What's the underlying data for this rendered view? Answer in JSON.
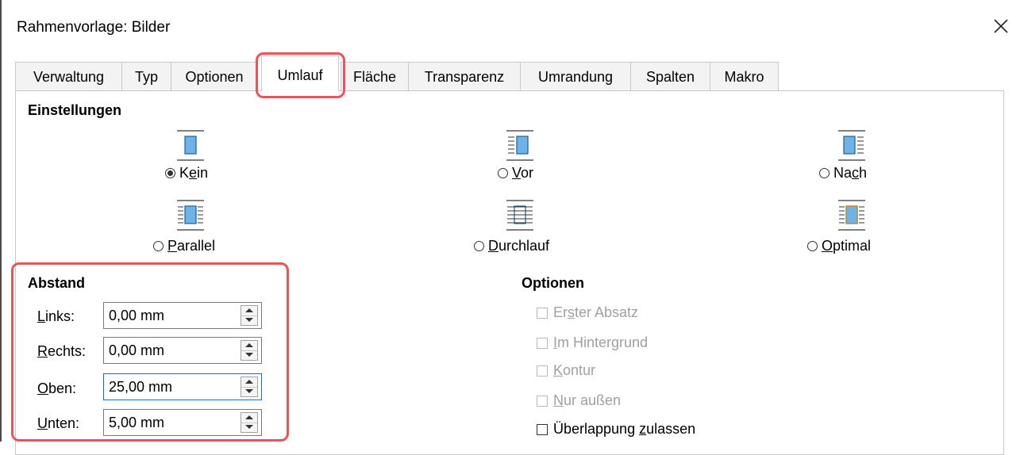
{
  "window": {
    "title": "Rahmenvorlage: Bilder"
  },
  "tabs": [
    {
      "label": "Verwaltung",
      "active": false
    },
    {
      "label": "Typ",
      "active": false
    },
    {
      "label": "Optionen",
      "active": false
    },
    {
      "label": "Umlauf",
      "active": true
    },
    {
      "label": "Fläche",
      "active": false
    },
    {
      "label": "Transparenz",
      "active": false
    },
    {
      "label": "Umrandung",
      "active": false
    },
    {
      "label": "Spalten",
      "active": false
    },
    {
      "label": "Makro",
      "active": false
    }
  ],
  "settings": {
    "heading": "Einstellungen",
    "wrap_options": [
      {
        "pre": "K",
        "mnemonic": "e",
        "post": "in",
        "checked": true,
        "icon": "wrap-none-icon"
      },
      {
        "pre": "",
        "mnemonic": "V",
        "post": "or",
        "checked": false,
        "icon": "wrap-before-icon"
      },
      {
        "pre": "Na",
        "mnemonic": "c",
        "post": "h",
        "checked": false,
        "icon": "wrap-after-icon"
      },
      {
        "pre": "",
        "mnemonic": "P",
        "post": "arallel",
        "checked": false,
        "icon": "wrap-parallel-icon"
      },
      {
        "pre": "",
        "mnemonic": "D",
        "post": "urchlauf",
        "checked": false,
        "icon": "wrap-through-icon"
      },
      {
        "pre": "",
        "mnemonic": "O",
        "post": "ptimal",
        "checked": false,
        "icon": "wrap-optimal-icon"
      }
    ]
  },
  "spacing": {
    "heading": "Abstand",
    "fields": [
      {
        "mnemonic": "L",
        "post": "inks:",
        "value": "0,00 mm"
      },
      {
        "mnemonic": "R",
        "post": "echts:",
        "value": "0,00 mm"
      },
      {
        "mnemonic": "O",
        "post": "ben:",
        "value": "25,00 mm"
      },
      {
        "mnemonic": "U",
        "post": "nten:",
        "value": "5,00 mm"
      }
    ]
  },
  "options": {
    "heading": "Optionen",
    "items": [
      {
        "pre": "Er",
        "mnemonic": "s",
        "post": "ter Absatz",
        "checked": false,
        "enabled": false
      },
      {
        "pre": "",
        "mnemonic": "I",
        "post": "m Hintergrund",
        "checked": false,
        "enabled": false
      },
      {
        "pre": "",
        "mnemonic": "K",
        "post": "ontur",
        "checked": false,
        "enabled": false
      },
      {
        "pre": "",
        "mnemonic": "N",
        "post": "ur außen",
        "checked": false,
        "enabled": false
      },
      {
        "pre": "Überlappung ",
        "mnemonic": "z",
        "post": "ulassen",
        "checked": false,
        "enabled": true
      }
    ]
  },
  "colors": {
    "highlight": "#e8545a",
    "focus": "#0078d7",
    "icon_fill": "#6db3e6"
  }
}
